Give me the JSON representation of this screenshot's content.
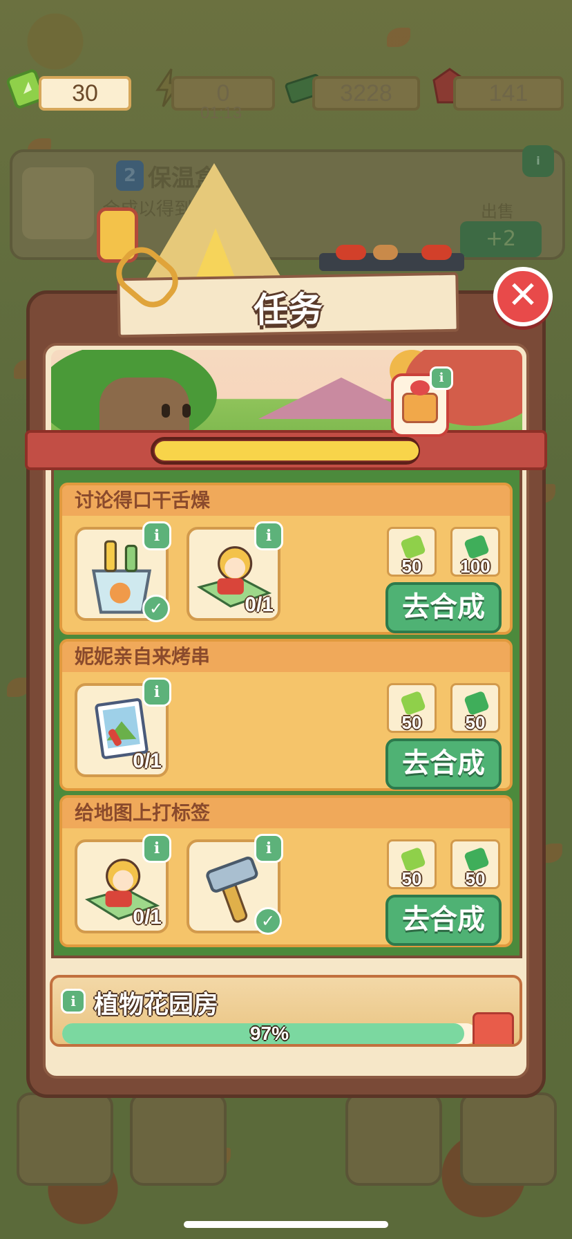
{
  "currency_bar": {
    "tickets": "30",
    "energy": "0",
    "energy_timer": "01:13",
    "cash": "3228",
    "gems": "141"
  },
  "background_card": {
    "level": "2",
    "title": "保温盒",
    "subtitle": "合成以得到...箱。",
    "sell_label": "出售",
    "sell_value": "+2"
  },
  "dialog": {
    "title": "任务",
    "close_label": "✕",
    "progress": 0.0,
    "tasks": [
      {
        "title": "讨论得口干舌燥",
        "items": [
          {
            "icon": "ice-bucket-drinks-icon",
            "count": "",
            "done": true
          },
          {
            "icon": "explorer-map-icon",
            "count": "0/1",
            "done": false
          }
        ],
        "rewards": [
          {
            "icon": "ticket-icon",
            "amount": "50",
            "color": "#8fd04a"
          },
          {
            "icon": "cash-icon",
            "amount": "100",
            "color": "#3fae5a"
          }
        ],
        "button": "去合成"
      },
      {
        "title": "妮妮亲自来烤串",
        "items": [
          {
            "icon": "photo-card-icon",
            "count": "0/1",
            "done": false
          }
        ],
        "rewards": [
          {
            "icon": "ticket-icon",
            "amount": "50",
            "color": "#8fd04a"
          },
          {
            "icon": "cash-icon",
            "amount": "50",
            "color": "#3fae5a"
          }
        ],
        "button": "去合成"
      },
      {
        "title": "给地图上打标签",
        "items": [
          {
            "icon": "explorer-map-icon",
            "count": "0/1",
            "done": false
          },
          {
            "icon": "hammer-icon",
            "count": "",
            "done": true
          }
        ],
        "rewards": [
          {
            "icon": "ticket-icon",
            "amount": "50",
            "color": "#8fd04a"
          },
          {
            "icon": "cash-icon",
            "amount": "50",
            "color": "#3fae5a"
          }
        ],
        "button": "去合成"
      }
    ],
    "garden": {
      "title": "植物花园房",
      "progress_label": "97%",
      "progress": 0.97
    }
  },
  "info_label": "i",
  "check_label": "✓"
}
